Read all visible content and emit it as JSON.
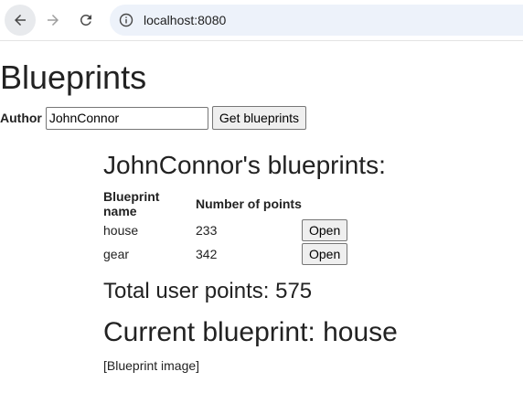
{
  "browser": {
    "url": "localhost:8080"
  },
  "page": {
    "title": "Blueprints",
    "author_label": "Author",
    "author_value": "JohnConnor",
    "get_button": "Get blueprints",
    "section_title": "JohnConnor's blueprints:",
    "table": {
      "headers": [
        "Blueprint name",
        "Number of points"
      ],
      "rows": [
        {
          "name": "house",
          "points": "233",
          "action": "Open"
        },
        {
          "name": "gear",
          "points": "342",
          "action": "Open"
        }
      ]
    },
    "total_points": "Total user points: 575",
    "current_blueprint": "Current blueprint: house",
    "image_placeholder": "[Blueprint image]"
  },
  "icons": {
    "back": "arrow-left-icon",
    "forward": "arrow-right-icon",
    "reload": "reload-icon",
    "site_info": "info-icon"
  }
}
